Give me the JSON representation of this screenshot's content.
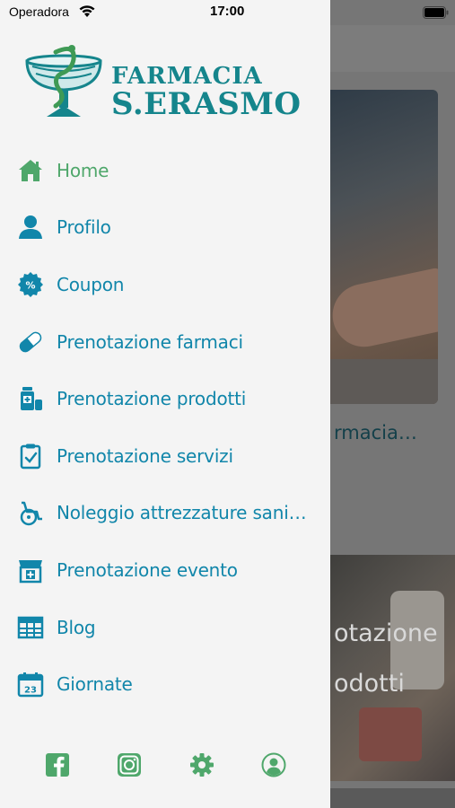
{
  "status_bar": {
    "carrier": "Operadora",
    "time": "17:00"
  },
  "logo": {
    "line1": "FARMACIA",
    "line2": "S.ERASMO"
  },
  "colors": {
    "menu_text": "#1186aa",
    "active_text": "#4fa76b",
    "footer_icons": "#4fa76b",
    "logo_teal": "#15858c"
  },
  "menu": {
    "items": [
      {
        "label": "Home",
        "icon": "home-icon",
        "active": true
      },
      {
        "label": "Profilo",
        "icon": "user-icon",
        "active": false
      },
      {
        "label": "Coupon",
        "icon": "coupon-badge-icon",
        "active": false
      },
      {
        "label": "Prenotazione farmaci",
        "icon": "pill-icon",
        "active": false
      },
      {
        "label": "Prenotazione prodotti",
        "icon": "products-icon",
        "active": false
      },
      {
        "label": "Prenotazione servizi",
        "icon": "clipboard-check-icon",
        "active": false
      },
      {
        "label": "Noleggio attrezzature sanitarie",
        "icon": "wheelchair-icon",
        "active": false
      },
      {
        "label": "Prenotazione evento",
        "icon": "pharmacy-store-icon",
        "active": false
      },
      {
        "label": "Blog",
        "icon": "blog-grid-icon",
        "active": false
      },
      {
        "label": "Giornate",
        "icon": "calendar-icon",
        "active": false
      }
    ]
  },
  "calendar_day": "23",
  "footer": {
    "icons": [
      "facebook-icon",
      "instagram-icon",
      "settings-gear-icon",
      "account-icon"
    ]
  },
  "background": {
    "card1_caption": "rmacia…",
    "card2_line1": "otazione",
    "card2_line2": "odotti"
  }
}
